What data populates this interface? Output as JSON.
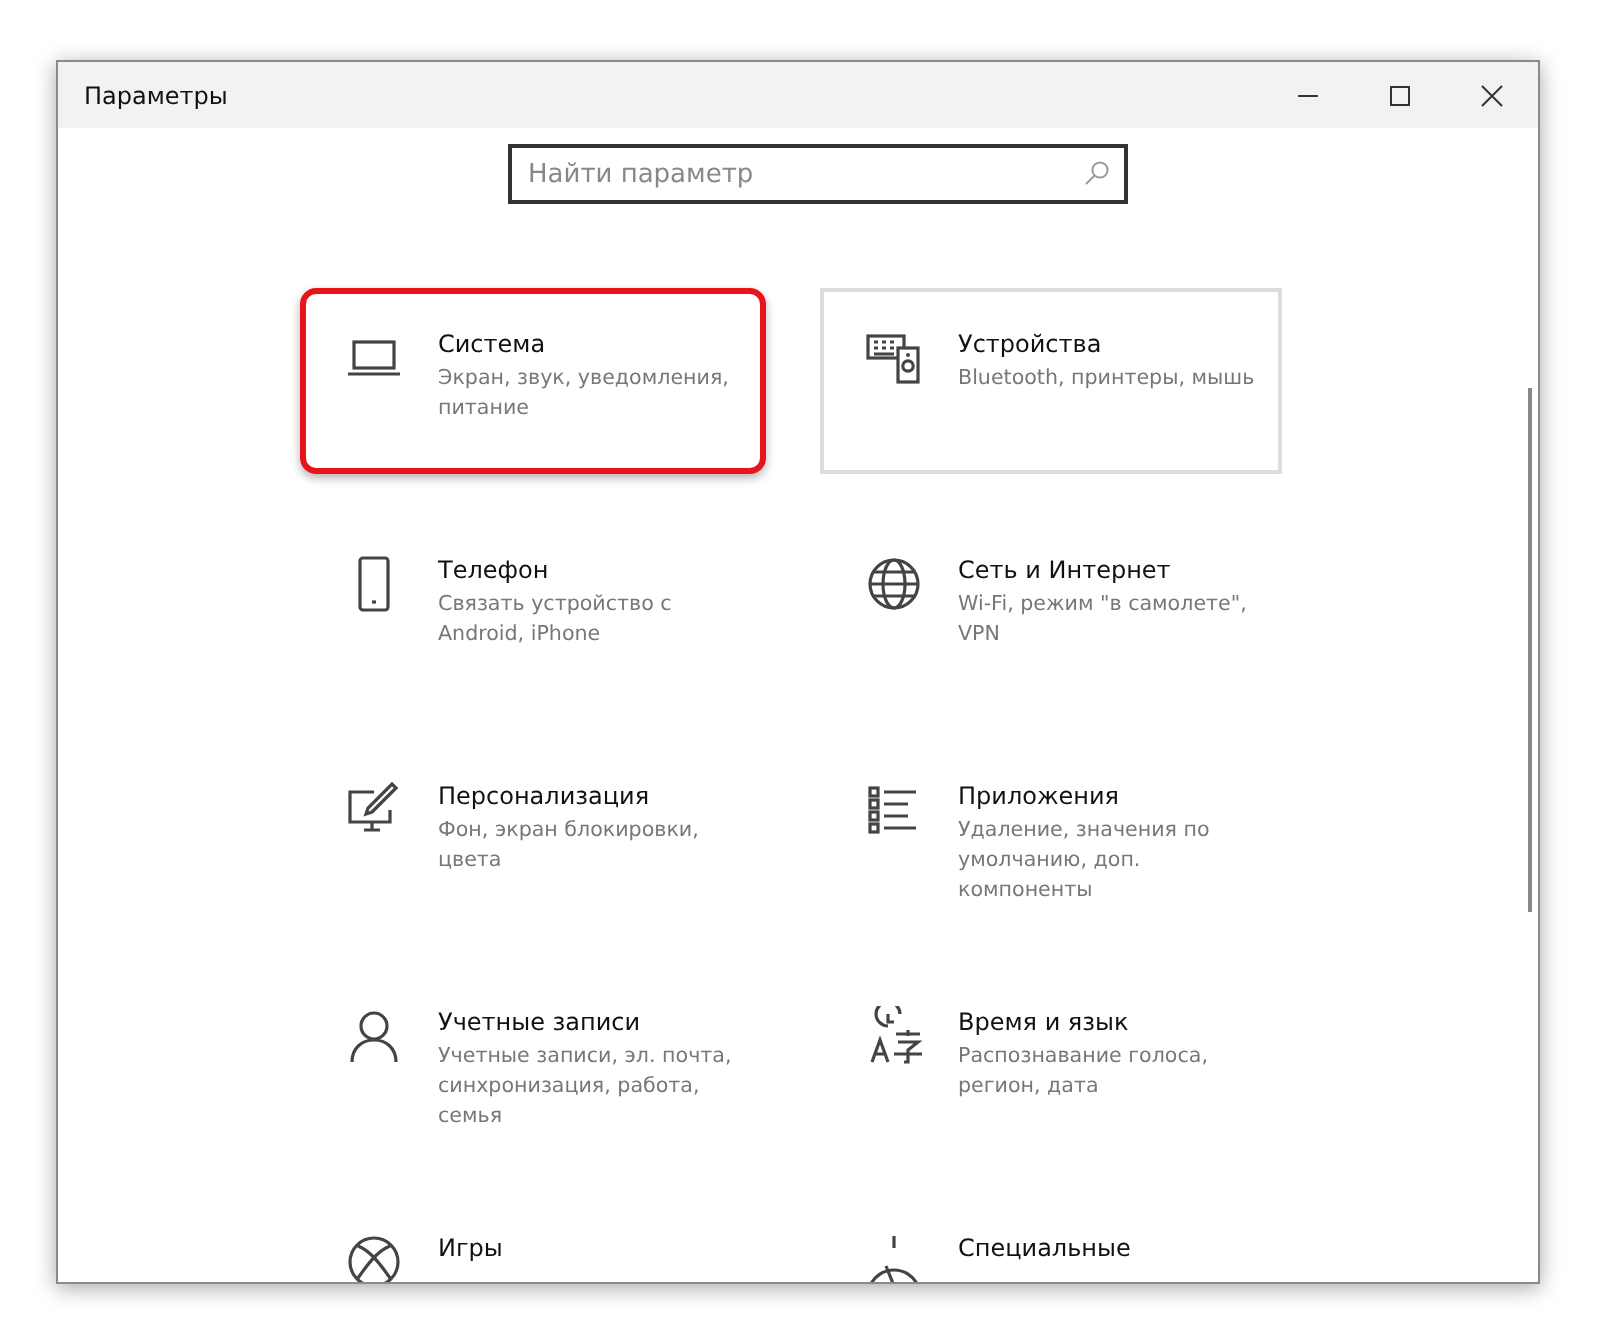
{
  "window": {
    "title": "Параметры"
  },
  "search": {
    "placeholder": "Найти параметр"
  },
  "tiles": [
    {
      "title": "Система",
      "subtitle": "Экран, звук, уведомления, питание",
      "annotated": true,
      "hovered": false
    },
    {
      "title": "Устройства",
      "subtitle": "Bluetooth, принтеры, мышь",
      "annotated": false,
      "hovered": true
    },
    {
      "title": "Телефон",
      "subtitle": "Связать устройство с Android, iPhone",
      "annotated": false,
      "hovered": false
    },
    {
      "title": "Сеть и Интернет",
      "subtitle": "Wi-Fi, режим \"в самолете\", VPN",
      "annotated": false,
      "hovered": false
    },
    {
      "title": "Персонализация",
      "subtitle": "Фон, экран блокировки, цвета",
      "annotated": false,
      "hovered": false
    },
    {
      "title": "Приложения",
      "subtitle": "Удаление, значения по умолчанию, доп. компоненты",
      "annotated": false,
      "hovered": false
    },
    {
      "title": "Учетные записи",
      "subtitle": "Учетные записи, эл. почта, синхронизация, работа, семья",
      "annotated": false,
      "hovered": false
    },
    {
      "title": "Время и язык",
      "subtitle": "Распознавание голоса, регион, дата",
      "annotated": false,
      "hovered": false
    },
    {
      "title": "Игры",
      "annotated": false,
      "hovered": false
    },
    {
      "title": "Специальные",
      "annotated": false,
      "hovered": false
    }
  ]
}
